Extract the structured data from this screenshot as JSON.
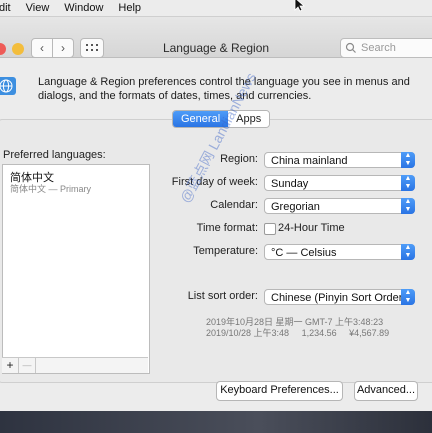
{
  "menubar": {
    "items": [
      "dit",
      "View",
      "Window",
      "Help"
    ]
  },
  "window": {
    "title": "Language & Region",
    "search_placeholder": "Search",
    "intro": "Language & Region preferences control the language you see in menus and dialogs, and the formats of dates, times, and currencies.",
    "tabs": [
      {
        "label": "General",
        "active": true
      },
      {
        "label": "Apps",
        "active": false
      }
    ]
  },
  "preferred": {
    "label": "Preferred languages:",
    "items": [
      {
        "name": "简体中文",
        "sub": "简体中文 — Primary"
      }
    ],
    "add": "+",
    "remove": "—"
  },
  "settings": {
    "region": {
      "label": "Region:",
      "value": "China mainland"
    },
    "first_day": {
      "label": "First day of week:",
      "value": "Sunday"
    },
    "calendar": {
      "label": "Calendar:",
      "value": "Gregorian"
    },
    "time_format": {
      "label": "Time format:",
      "value": "24-Hour Time",
      "checked": false
    },
    "temperature": {
      "label": "Temperature:",
      "value": "°C — Celsius"
    },
    "sort": {
      "label": "List sort order:",
      "value": "Chinese (Pinyin Sort Order)"
    },
    "sample_line1": "2019年10月28日 星期一 GMT-7 上午3:48:23",
    "sample_line2": "2019/10/28 上午3:48     1,234.56     ¥4,567.89"
  },
  "buttons": {
    "keyboard": "Keyboard Preferences...",
    "advanced": "Advanced..."
  },
  "watermark": "@蓝点网 LandianNews",
  "colors": {
    "accent": "#2a74e4"
  }
}
